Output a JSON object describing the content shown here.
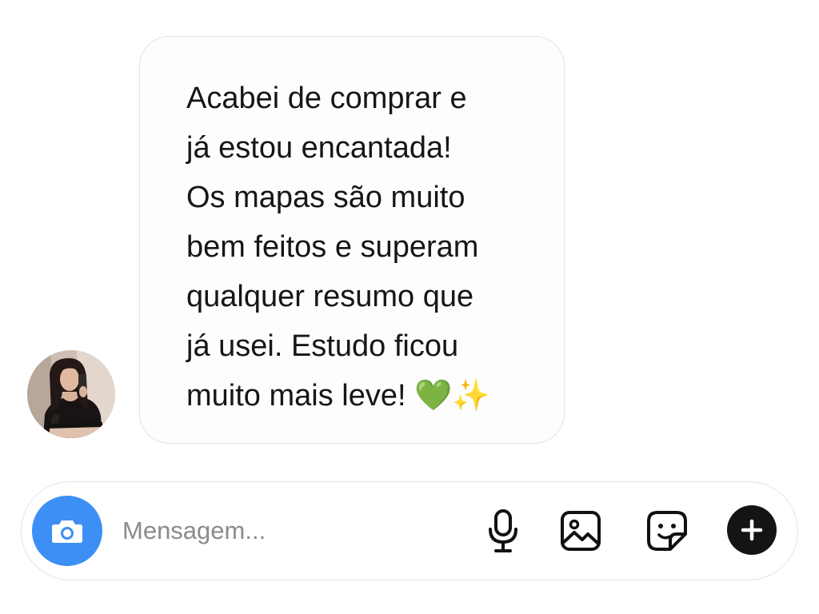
{
  "message": {
    "text": "Acabei de comprar e\njá estou encantada!\nOs mapas são muito\nbem feitos e superam\nqualquer resumo que\njá usei. Estudo ficou\nmuito mais leve! 💚✨"
  },
  "sender": {
    "avatar_icon": "profile-photo"
  },
  "composer": {
    "placeholder": "Mensagem...",
    "camera_icon": "camera-icon",
    "mic_icon": "microphone-icon",
    "gallery_icon": "image-icon",
    "sticker_icon": "sticker-icon",
    "plus_icon": "plus-icon"
  },
  "colors": {
    "accent": "#3d8ff5",
    "plus_button": "#141414",
    "bubble_border": "#e2e2e2",
    "text": "#161616",
    "placeholder": "#8b8b8b"
  }
}
